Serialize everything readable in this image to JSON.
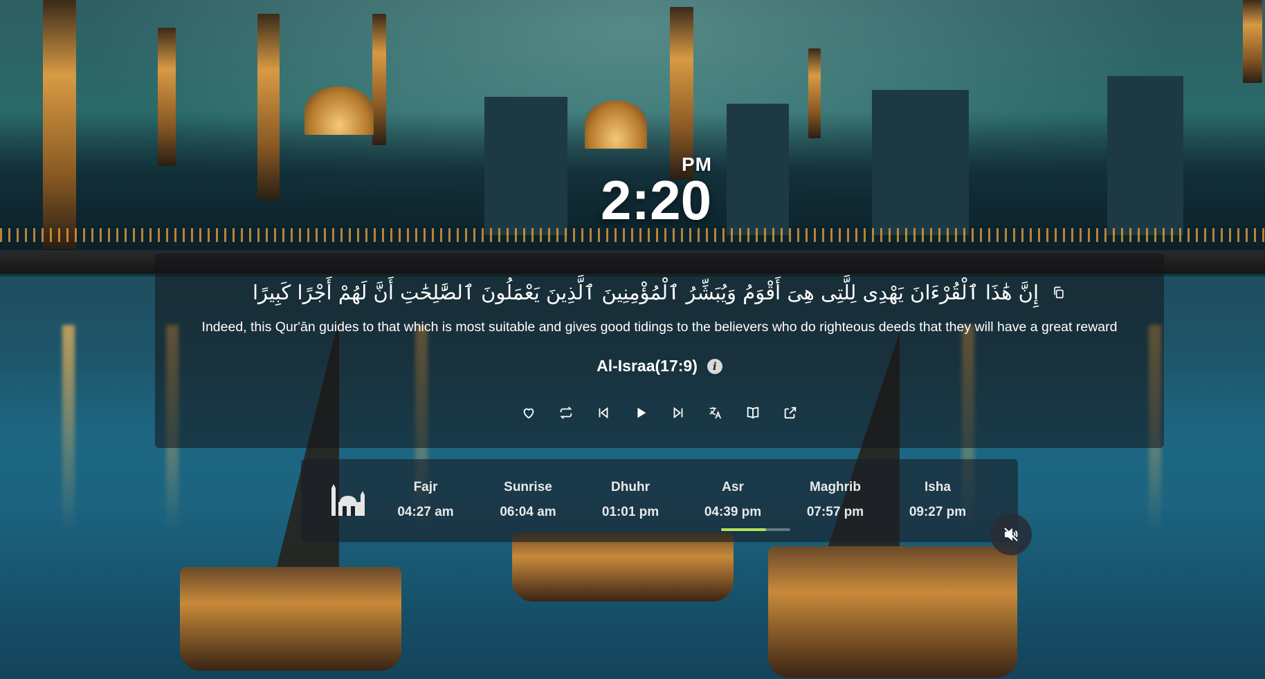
{
  "clock": {
    "period": "PM",
    "time": "2:20"
  },
  "verse": {
    "arabic": "إِنَّ هَٰذَا ٱلْقُرْءَانَ يَهْدِى لِلَّتِى هِىَ أَقْوَمُ وَيُبَشِّرُ ٱلْمُؤْمِنِينَ ٱلَّذِينَ يَعْمَلُونَ ٱلصَّٰلِحَٰتِ أَنَّ لَهُمْ أَجْرًا كَبِيرًا",
    "translation": "Indeed, this Qur'ān guides to that which is most suitable and gives good tidings to the believers who do righteous deeds that they will have a great reward",
    "reference": "Al-Israa(17:9)"
  },
  "controls": [
    {
      "name": "favorite",
      "icon": "heart-icon"
    },
    {
      "name": "repeat",
      "icon": "repeat-icon"
    },
    {
      "name": "previous",
      "icon": "skip-previous-icon"
    },
    {
      "name": "play",
      "icon": "play-icon"
    },
    {
      "name": "next",
      "icon": "skip-next-icon"
    },
    {
      "name": "translate",
      "icon": "translate-icon"
    },
    {
      "name": "read",
      "icon": "book-open-icon"
    },
    {
      "name": "open-external",
      "icon": "external-link-icon"
    }
  ],
  "prayers": [
    {
      "name": "Fajr",
      "time": "04:27 am"
    },
    {
      "name": "Sunrise",
      "time": "06:04 am"
    },
    {
      "name": "Dhuhr",
      "time": "01:01 pm"
    },
    {
      "name": "Asr",
      "time": "04:39 pm"
    },
    {
      "name": "Maghrib",
      "time": "07:57 pm"
    },
    {
      "name": "Isha",
      "time": "09:27 pm"
    }
  ],
  "next_prayer_progress": {
    "prayer": "Asr",
    "fraction": 0.65,
    "color": "#b8e05a"
  },
  "sound": {
    "muted": true,
    "icon": "volume-mute-icon"
  }
}
